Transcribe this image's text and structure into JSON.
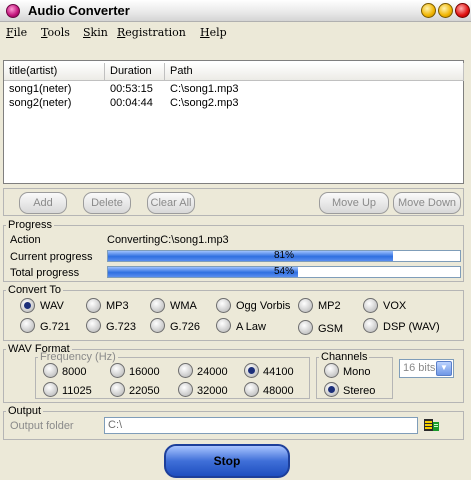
{
  "window": {
    "title": "Audio Converter"
  },
  "menu": [
    "File",
    "Tools",
    "Skin",
    "Registration",
    "Help"
  ],
  "list": {
    "columns": [
      "title(artist)",
      "Duration",
      "Path"
    ],
    "rows": [
      [
        "song1(neter)",
        "00:53:15",
        "C:\\song1.mp3"
      ],
      [
        "song2(neter)",
        "00:04:44",
        "C:\\song2.mp3"
      ]
    ]
  },
  "buttons": {
    "add": "Add",
    "delete": "Delete",
    "clear_all": "Clear All",
    "move_up": "Move Up",
    "move_down": "Move Down"
  },
  "progress": {
    "legend": "Progress",
    "action_label": "Action",
    "action_value": "ConvertingC:\\song1.mp3",
    "current_label": "Current progress",
    "current_value": "81%",
    "current_fraction": 0.81,
    "total_label": "Total progress",
    "total_value": "54%",
    "total_fraction": 0.54
  },
  "convert_to": {
    "legend": "Convert To",
    "options": [
      "WAV",
      "MP3",
      "WMA",
      "Ogg Vorbis",
      "MP2",
      "VOX",
      "G.721",
      "G.723",
      "G.726",
      "A Law",
      "GSM",
      "DSP (WAV)"
    ],
    "selected": "WAV"
  },
  "wav_format": {
    "legend": "WAV Format",
    "frequency_legend": "Frequency (Hz)",
    "frequencies": [
      "8000",
      "16000",
      "24000",
      "44100",
      "11025",
      "22050",
      "32000",
      "48000"
    ],
    "selected_frequency": "44100",
    "channels_legend": "Channels",
    "channels": [
      "Mono",
      "Stereo"
    ],
    "selected_channel": "Stereo",
    "bits_value": "16 bits"
  },
  "output": {
    "legend": "Output",
    "folder_label": "Output folder",
    "folder_value": "C:\\"
  },
  "stop_button": "Stop",
  "colors": {
    "progress_fill": "#2f6fe0",
    "stop_button": "#3f6fd8"
  }
}
